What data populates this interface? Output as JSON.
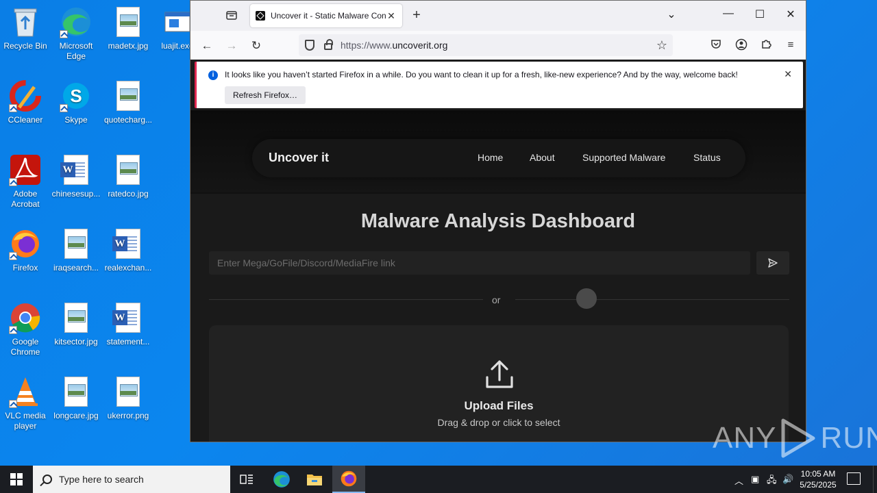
{
  "desktop": {
    "icons": [
      {
        "label": "Recycle Bin",
        "type": "recycle"
      },
      {
        "label": "Microsoft Edge",
        "type": "edge"
      },
      {
        "label": "madetx.jpg",
        "type": "image"
      },
      {
        "label": "luajit.exe",
        "type": "exe"
      },
      {
        "label": "CCleaner",
        "type": "ccleaner"
      },
      {
        "label": "Skype",
        "type": "skype"
      },
      {
        "label": "quotecharg...",
        "type": "image"
      },
      {
        "label": "Adobe Acrobat",
        "type": "acrobat"
      },
      {
        "label": "chinesesup...",
        "type": "word"
      },
      {
        "label": "ratedco.jpg",
        "type": "image"
      },
      {
        "label": "Firefox",
        "type": "firefox"
      },
      {
        "label": "iraqsearch...",
        "type": "image"
      },
      {
        "label": "realexchan...",
        "type": "word"
      },
      {
        "label": "Google Chrome",
        "type": "chrome"
      },
      {
        "label": "kitsector.jpg",
        "type": "image"
      },
      {
        "label": "statement...",
        "type": "word"
      },
      {
        "label": "VLC media player",
        "type": "vlc"
      },
      {
        "label": "longcare.jpg",
        "type": "image"
      },
      {
        "label": "ukerror.png",
        "type": "image"
      }
    ]
  },
  "browser": {
    "tab_title": "Uncover it - Static Malware Con",
    "url_prefix": "https://www.",
    "url_domain": "uncoverit.org",
    "notification": {
      "message": "It looks like you haven’t started Firefox in a while. Do you want to clean it up for a fresh, like-new experience? And by the way, welcome back!",
      "button": "Refresh Firefox…"
    }
  },
  "site": {
    "brand": "Uncover it",
    "nav": [
      "Home",
      "About",
      "Supported Malware",
      "Status"
    ],
    "title": "Malware Analysis Dashboard",
    "input_placeholder": "Enter Mega/GoFile/Discord/MediaFire link",
    "or_text": "or",
    "upload_title": "Upload Files",
    "upload_subtitle": "Drag & drop or click to select"
  },
  "watermark": {
    "left": "ANY",
    "right": "RUN"
  },
  "taskbar": {
    "search_placeholder": "Type here to search",
    "time": "10:05 AM",
    "date": "5/25/2025"
  }
}
